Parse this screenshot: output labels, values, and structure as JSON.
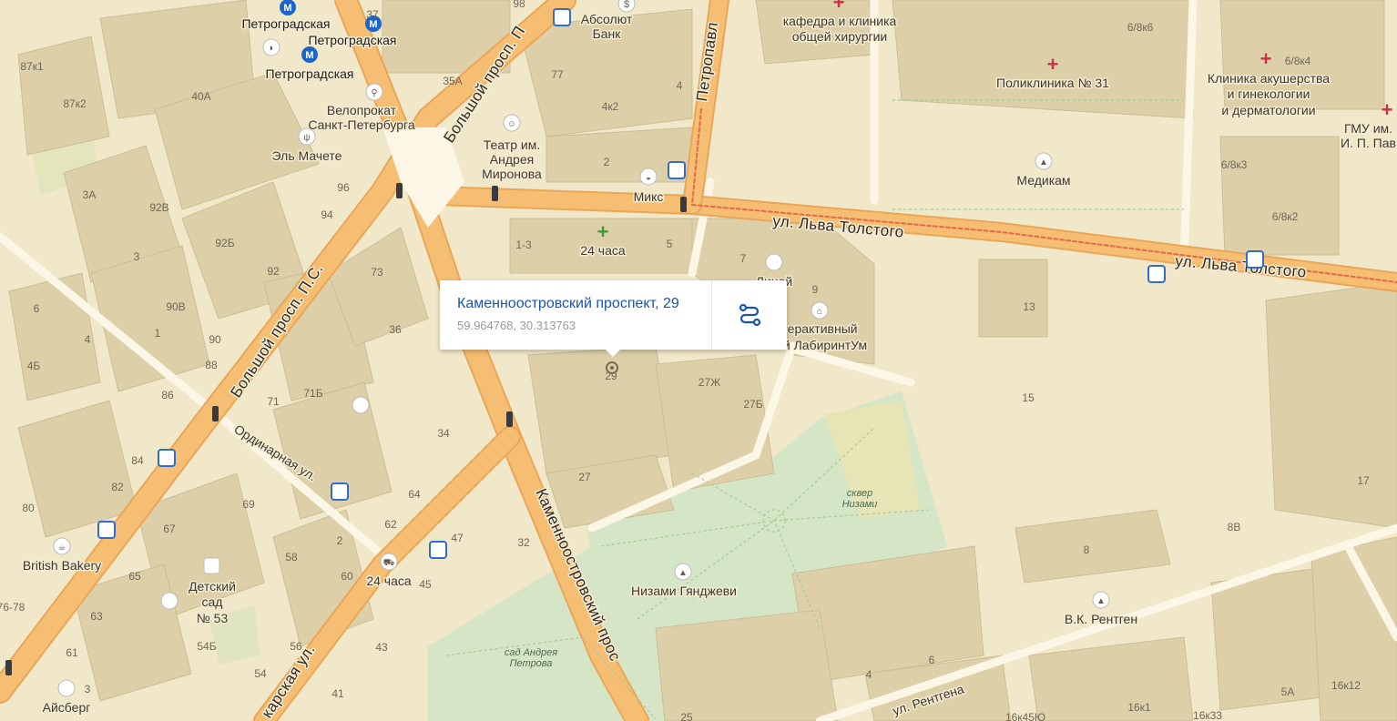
{
  "popup": {
    "address": "Каменноостровский проспект, 29",
    "coordinates": "59.964768, 30.313763",
    "route_icon": "route-icon"
  },
  "streets": {
    "lva_tolstogo_1": "ул. Льва Толстого",
    "lva_tolstogo_2": "ул. Льва Толстого",
    "bolshoy_prosp_1": "Большой просп. П.С.",
    "bolshoy_prosp_2": "Большой просп. П",
    "kamennoostrovsky": "Каменноостровский прос",
    "petropavl": "Петропавл",
    "ordinarnaya": "Ординарная ул.",
    "rentgena": "ул. Рентгена",
    "karskaya": "карская ул."
  },
  "pois": {
    "metro1": "Петроградская",
    "metro2": "Петроградская",
    "metro3": "Петроградская",
    "absolut_1": "Абсолют",
    "absolut_2": "Банк",
    "velo_1": "Велопрокат",
    "velo_2": "Санкт-Петербурга",
    "el_machete": "Эль Мачете",
    "teatr_1": "Театр им.",
    "teatr_2": "Андрея",
    "teatr_3": "Миронова",
    "miks": "Микс",
    "pharmacy": "24 часа",
    "liceum": "Лицей",
    "labyrinth_1": "терактивный",
    "labyrinth_2": "й ЛабиринтУм",
    "kafedra_1": "кафедра и клиника",
    "kafedra_2": "общей хирургии",
    "poliklinika": "Поликлиника № 31",
    "klinika_1": "Клиника акушерства",
    "klinika_2": "и гинекологии",
    "klinika_3": "и дерматологии",
    "gmu_1": "ГМУ им.",
    "gmu_2": "И. П. Пав",
    "medikam": "Медикам",
    "british": "British Bakery",
    "detsad_1": "Детский",
    "detsad_2": "сад",
    "detsad_3": "№ 53",
    "shop24": "24 часа",
    "aisberg": "Айсберг",
    "nizami": "Низами Гянджеви",
    "rentgen": "В.К. Рентген",
    "skver_1": "сквер",
    "skver_2": "Низами",
    "sad_1": "сад Андрея",
    "sad_2": "Петрова"
  },
  "house_numbers": [
    "98",
    "37",
    "35А",
    "77",
    "4",
    "4к2",
    "2",
    "87к1",
    "87к2",
    "40А",
    "96",
    "94",
    "3А",
    "92В",
    "92Б",
    "92",
    "3",
    "90В",
    "90",
    "1",
    "88",
    "86",
    "84",
    "82",
    "80",
    "6",
    "4",
    "4Б",
    "1-3",
    "5",
    "7",
    "9",
    "73",
    "36",
    "71",
    "71Б",
    "34",
    "64",
    "62",
    "69",
    "67",
    "65",
    "63",
    "61",
    "58",
    "60",
    "2",
    "56",
    "54",
    "54Б",
    "47",
    "45",
    "43",
    "41",
    "32",
    "3",
    "25",
    "27",
    "27Ж",
    "27Б",
    "29",
    "13",
    "15",
    "17",
    "8",
    "8В",
    "6",
    "4",
    "16к45Ю",
    "16к1",
    "16к33",
    "16к12",
    "5А",
    "6/8к6",
    "6/8к4",
    "6/8к3",
    "6/8к2",
    "76-78"
  ],
  "colors": {
    "background": "#f1e8c9",
    "building": "#ddd0a8",
    "road_major": "#f6be72",
    "park": "#d5e6c6",
    "link": "#1a54b0"
  }
}
